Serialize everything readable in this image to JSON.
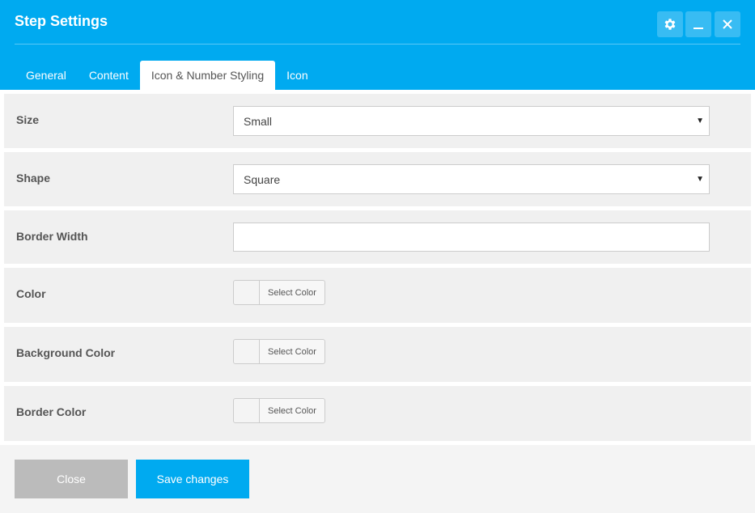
{
  "dialog": {
    "title": "Step Settings"
  },
  "header_controls": [
    {
      "name": "settings",
      "icon": "gear-icon"
    },
    {
      "name": "minimize",
      "icon": "minimize-icon"
    },
    {
      "name": "close",
      "icon": "close-icon"
    }
  ],
  "tabs": [
    {
      "label": "General",
      "active": false
    },
    {
      "label": "Content",
      "active": false
    },
    {
      "label": "Icon & Number Styling",
      "active": true
    },
    {
      "label": "Icon",
      "active": false
    }
  ],
  "fields": {
    "size": {
      "label": "Size",
      "value": "Small"
    },
    "shape": {
      "label": "Shape",
      "value": "Square"
    },
    "border_width": {
      "label": "Border Width",
      "value": "",
      "placeholder": ""
    },
    "color": {
      "label": "Color",
      "button": "Select Color"
    },
    "background_color": {
      "label": "Background Color",
      "button": "Select Color"
    },
    "border_color": {
      "label": "Border Color",
      "button": "Select Color"
    }
  },
  "footer": {
    "close_label": "Close",
    "save_label": "Save changes"
  },
  "colors": {
    "accent": "#00aaf0",
    "row_bg": "#f0f0f0",
    "close_button": "#bbbbbb"
  }
}
